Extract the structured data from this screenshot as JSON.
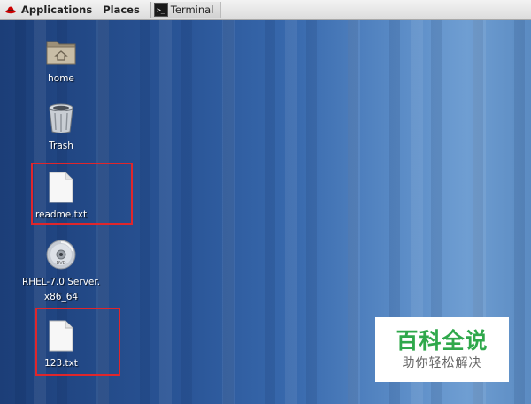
{
  "top_panel": {
    "applications_label": "Applications",
    "places_label": "Places",
    "task_terminal_label": "Terminal"
  },
  "desktop": {
    "items": [
      {
        "label": "home",
        "icon": "folder-home-icon"
      },
      {
        "label": "Trash",
        "icon": "trash-icon"
      },
      {
        "label": "readme.txt",
        "icon": "text-file-icon"
      },
      {
        "label_line1": "RHEL-7.0 Server.",
        "label_line2": "x86_64",
        "icon": "optical-disc-icon"
      },
      {
        "label": "123.txt",
        "icon": "text-file-icon"
      }
    ]
  },
  "watermark": {
    "title": "百科全说",
    "subtitle": "助你轻松解决"
  },
  "colors": {
    "highlight_box": "#e0262b",
    "watermark_green": "#2fa84b",
    "desktop_blue": "#2a5597"
  }
}
